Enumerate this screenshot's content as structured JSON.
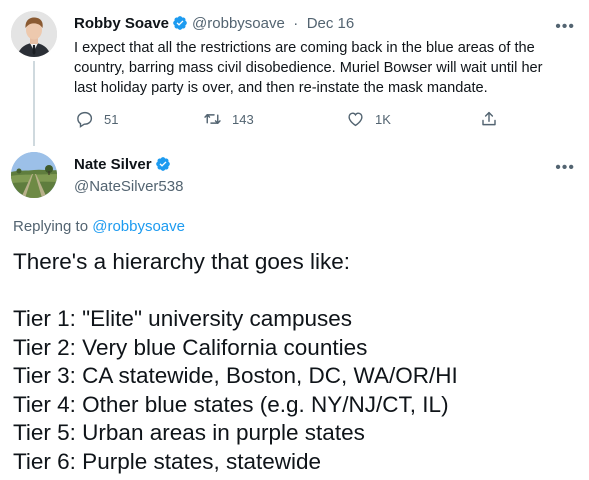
{
  "parent_tweet": {
    "author_name": "Robby Soave",
    "handle": "@robbysoave",
    "separator": "·",
    "date": "Dec 16",
    "text": "I expect that all the restrictions are coming back in the blue areas of the country, barring mass civil disobedience. Muriel Bowser will wait until her last holiday party is over, and then re-instate the mask mandate.",
    "replies": "51",
    "retweets": "143",
    "likes": "1K",
    "verified": true
  },
  "main_tweet": {
    "author_name": "Nate Silver",
    "handle": "@NateSilver538",
    "verified": true,
    "replying_prefix": "Replying to",
    "replying_to": "@robbysoave",
    "intro": "There's a hierarchy that goes like:",
    "tiers": [
      "Tier 1: \"Elite\" university campuses",
      "Tier 2: Very blue California counties",
      "Tier 3: CA statewide, Boston, DC, WA/OR/HI",
      "Tier 4: Other blue states (e.g. NY/NJ/CT, IL)",
      "Tier 5: Urban areas in purple states",
      "Tier 6: Purple states, statewide"
    ]
  },
  "icons": {
    "verified": "verified-badge-icon",
    "more": "more-options-icon",
    "reply": "reply-icon",
    "retweet": "retweet-icon",
    "like": "heart-icon",
    "share": "share-icon"
  },
  "colors": {
    "accent": "#1d9bf0",
    "secondary_text": "#536471",
    "primary_text": "#0f1419",
    "thread_line": "#cfd9de"
  }
}
